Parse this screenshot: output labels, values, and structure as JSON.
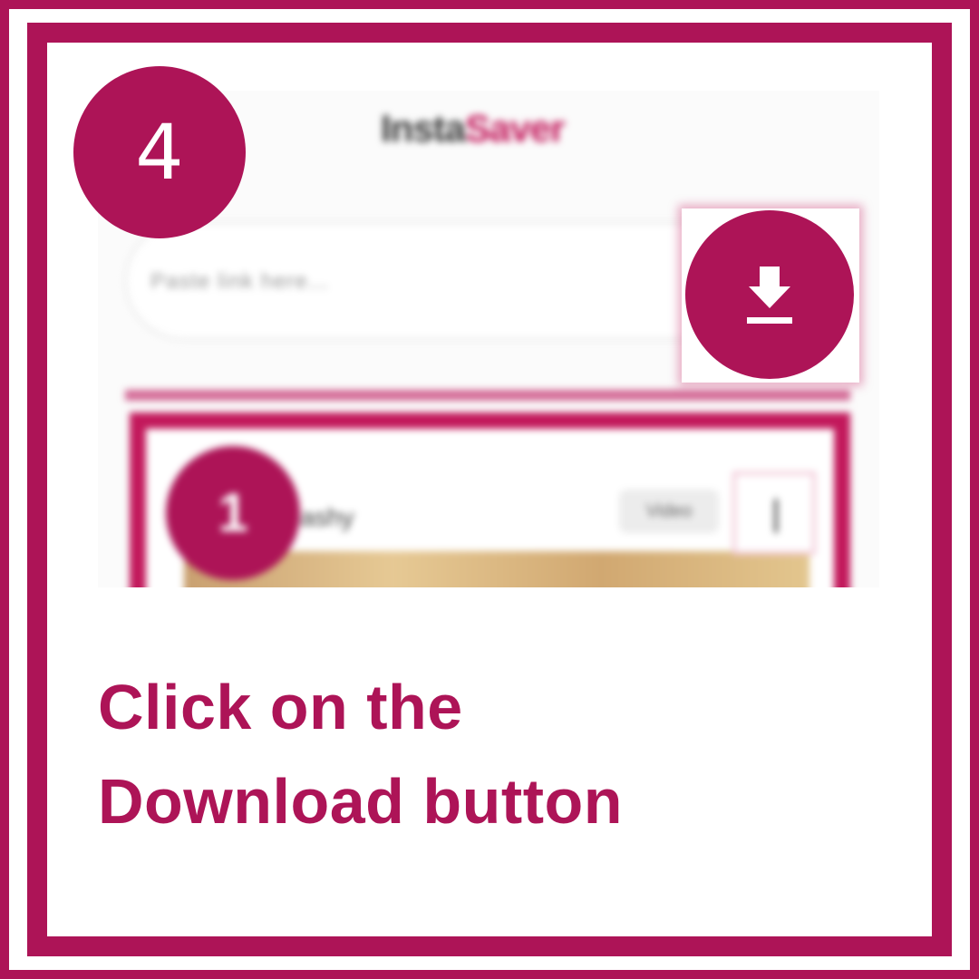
{
  "step_number": "4",
  "screenshot": {
    "logo_part1": "Insta",
    "logo_part2": "Saver",
    "search_placeholder": "Paste link here...",
    "card": {
      "index": "1",
      "name": "...ashy",
      "tag": "Video"
    }
  },
  "download_icon": "download-icon",
  "caption": {
    "line1": "Click on the",
    "line2": "Download button"
  },
  "colors": {
    "accent": "#ad1457",
    "logo_accent": "#c2185b",
    "background": "#ffffff"
  }
}
